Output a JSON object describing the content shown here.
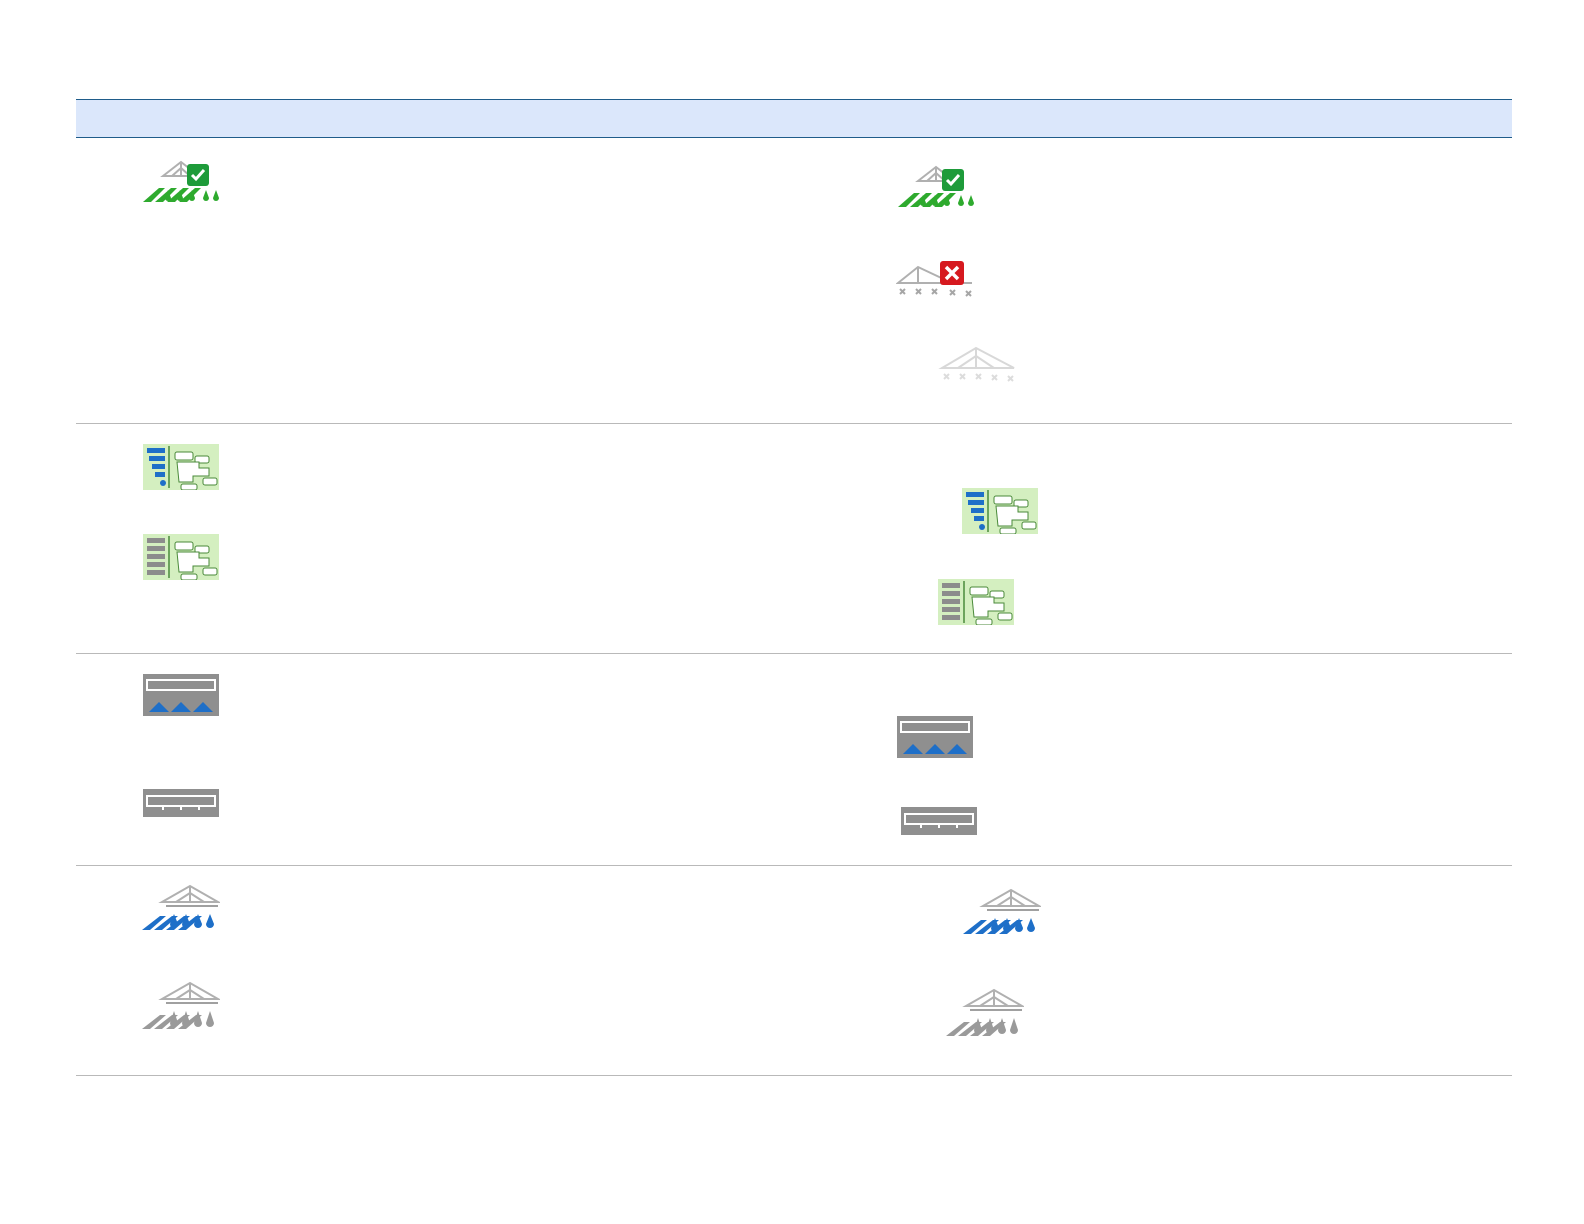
{
  "table": {
    "header": {
      "left": "",
      "right": ""
    },
    "rows": [
      {
        "left_icons": [
          "boom-on-check-icon"
        ],
        "right_icons": [
          "boom-on-check-icon",
          "boom-off-x-icon",
          "boom-disabled-icon"
        ]
      },
      {
        "left_icons": [
          "section-map-blue-icon",
          "section-map-gray-icon"
        ],
        "right_icons": [
          "section-map-blue-icon",
          "section-map-gray-icon"
        ]
      },
      {
        "left_icons": [
          "boom-bar-spray-icon",
          "boom-bar-empty-icon"
        ],
        "right_icons": [
          "boom-bar-spray-icon",
          "boom-bar-empty-icon"
        ]
      },
      {
        "left_icons": [
          "boom-blue-spray-icon",
          "boom-gray-spray-icon"
        ],
        "right_icons": [
          "boom-blue-spray-icon",
          "boom-gray-spray-icon"
        ]
      }
    ]
  },
  "colors": {
    "header_bg": "#dbe7fb",
    "header_border": "#1f5c8a",
    "row_divider": "#b9b9b9",
    "green_on": "#2eaa2e",
    "red_off": "#d6191f",
    "blue_spray": "#1e6fc8",
    "map_bg": "#d4efc0"
  }
}
